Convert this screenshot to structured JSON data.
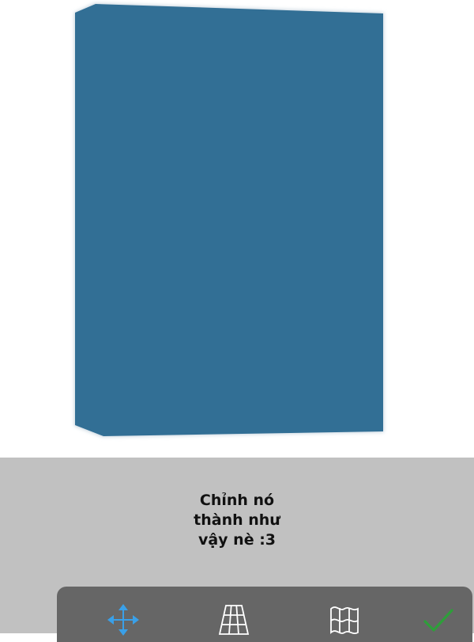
{
  "canvas": {
    "shape_color": "#326f95",
    "background": "#ffffff"
  },
  "caption": {
    "lines": [
      "Chỉnh nó",
      "thành như",
      "vậy nè :3"
    ]
  },
  "toolbar": {
    "background": "#666666",
    "tools": [
      {
        "name": "move",
        "icon": "move-arrows-icon",
        "color": "#3aa0e8",
        "selected": true
      },
      {
        "name": "perspective-grid",
        "icon": "perspective-grid-icon",
        "color": "#ffffff"
      },
      {
        "name": "warp",
        "icon": "warp-flag-icon",
        "color": "#ffffff"
      },
      {
        "name": "done",
        "icon": "checkmark-icon",
        "color": "#2e9e3a"
      }
    ]
  }
}
